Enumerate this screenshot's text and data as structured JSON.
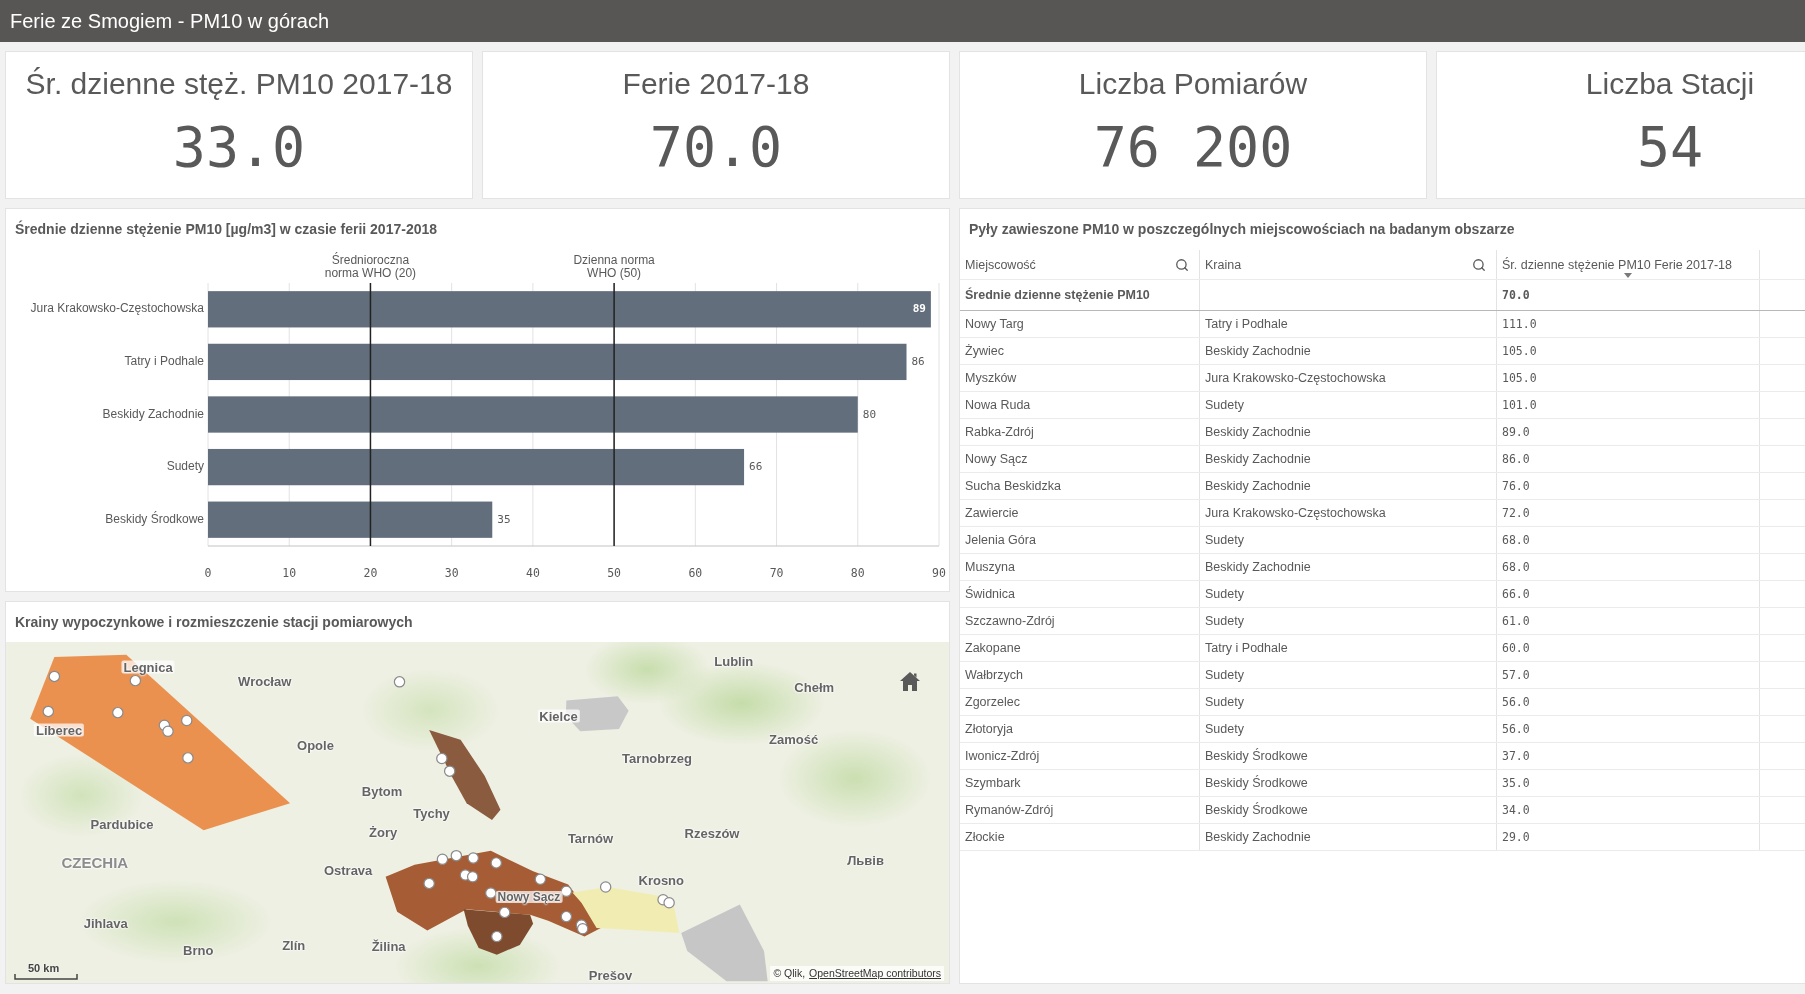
{
  "header": {
    "title": "Ferie ze Smogiem - PM10 w górach"
  },
  "kpis": [
    {
      "title": "Śr. dzienne stęż. PM10 2017-18",
      "value": "33.0"
    },
    {
      "title": "Ferie 2017-18",
      "value": "70.0"
    },
    {
      "title": "Liczba Pomiarów",
      "value": "76 200"
    },
    {
      "title": "Liczba Stacji",
      "value": "54"
    }
  ],
  "bar_chart": {
    "chart_data": {
      "type": "bar",
      "orientation": "horizontal",
      "title": "Średnie dzienne stężenie PM10 [µg/m3] w czasie ferii 2017-2018",
      "categories": [
        "Jura Krakowsko-Częstochowska",
        "Tatry i Podhale",
        "Beskidy Zachodnie",
        "Sudety",
        "Beskidy Środkowe"
      ],
      "values": [
        89,
        86,
        80,
        66,
        35
      ],
      "xlim": [
        0,
        90
      ],
      "xticks": [
        0,
        10,
        20,
        30,
        40,
        50,
        60,
        70,
        80,
        90
      ],
      "grid": true,
      "data_labels": true,
      "ref_lines": [
        {
          "axis": "x",
          "value": 20,
          "label": "Średnioroczna norma WHO (20)"
        },
        {
          "axis": "x",
          "value": 50,
          "label": "Dzienna norma WHO (50)"
        }
      ]
    }
  },
  "map": {
    "title": "Krainy wypoczynkowe i rozmieszczenie stacji pomiarowych",
    "areas": [
      {
        "color": "#c8c8c8"
      },
      {
        "color": "#ea9150"
      },
      {
        "color": "#8a5b3e"
      },
      {
        "color": "#a65c34"
      },
      {
        "color": "#7e4b2f"
      },
      {
        "color": "#f1edb2"
      },
      {
        "color": "#c6c6c6"
      }
    ],
    "place_labels": [
      {
        "text": "Legnica",
        "kind": "city"
      },
      {
        "text": "Wrocław",
        "kind": "city"
      },
      {
        "text": "Liberec",
        "kind": "city"
      },
      {
        "text": "Opole",
        "kind": "city"
      },
      {
        "text": "Bytom",
        "kind": "city"
      },
      {
        "text": "Tychy",
        "kind": "city"
      },
      {
        "text": "Żory",
        "kind": "city"
      },
      {
        "text": "Pardubice",
        "kind": "city"
      },
      {
        "text": "CZECHIA",
        "kind": "country"
      },
      {
        "text": "Ostrava",
        "kind": "city"
      },
      {
        "text": "Jihlava",
        "kind": "city"
      },
      {
        "text": "Brno",
        "kind": "city"
      },
      {
        "text": "Zlín",
        "kind": "city"
      },
      {
        "text": "Žilina",
        "kind": "city"
      },
      {
        "text": "Kielce",
        "kind": "city"
      },
      {
        "text": "Lublin",
        "kind": "city"
      },
      {
        "text": "Chełm",
        "kind": "city"
      },
      {
        "text": "Zamość",
        "kind": "city"
      },
      {
        "text": "Tarnobrzeg",
        "kind": "city"
      },
      {
        "text": "Tarnów",
        "kind": "city"
      },
      {
        "text": "Rzeszów",
        "kind": "city"
      },
      {
        "text": "Krosno",
        "kind": "city"
      },
      {
        "text": "Nowy Sącz",
        "kind": "city"
      },
      {
        "text": "Prešov",
        "kind": "city"
      },
      {
        "text": "Львів",
        "kind": "city"
      }
    ],
    "scale": "50 km",
    "attribution": {
      "text": "© Qlik,",
      "link": "OpenStreetMap contributors"
    }
  },
  "table": {
    "title": "Pyły zawieszone PM10 w poszczególnych miejscowościach na badanym obszarze",
    "columns": [
      {
        "label": "Miejscowość",
        "search": true,
        "sorted": false
      },
      {
        "label": "Kraina",
        "search": true,
        "sorted": false
      },
      {
        "label": "Śr. dzienne stężenie PM10 Ferie 2017-18",
        "search": false,
        "sorted": true
      }
    ],
    "totals": {
      "label": "Średnie dzienne stężenie PM10",
      "value": "70.0"
    },
    "rows": [
      [
        "Nowy Targ",
        "Tatry i Podhale",
        "111.0"
      ],
      [
        "Żywiec",
        "Beskidy Zachodnie",
        "105.0"
      ],
      [
        "Myszków",
        "Jura Krakowsko-Częstochowska",
        "105.0"
      ],
      [
        "Nowa Ruda",
        "Sudety",
        "101.0"
      ],
      [
        "Rabka-Zdrój",
        "Beskidy Zachodnie",
        "89.0"
      ],
      [
        "Nowy Sącz",
        "Beskidy Zachodnie",
        "86.0"
      ],
      [
        "Sucha Beskidzka",
        "Beskidy Zachodnie",
        "76.0"
      ],
      [
        "Zawiercie",
        "Jura Krakowsko-Częstochowska",
        "72.0"
      ],
      [
        "Jelenia Góra",
        "Sudety",
        "68.0"
      ],
      [
        "Muszyna",
        "Beskidy Zachodnie",
        "68.0"
      ],
      [
        "Świdnica",
        "Sudety",
        "66.0"
      ],
      [
        "Szczawno-Zdrój",
        "Sudety",
        "61.0"
      ],
      [
        "Zakopane",
        "Tatry i Podhale",
        "60.0"
      ],
      [
        "Wałbrzych",
        "Sudety",
        "57.0"
      ],
      [
        "Zgorzelec",
        "Sudety",
        "56.0"
      ],
      [
        "Złotoryja",
        "Sudety",
        "56.0"
      ],
      [
        "Iwonicz-Zdrój",
        "Beskidy Środkowe",
        "37.0"
      ],
      [
        "Szymbark",
        "Beskidy Środkowe",
        "35.0"
      ],
      [
        "Rymanów-Zdrój",
        "Beskidy Środkowe",
        "34.0"
      ],
      [
        "Złockie",
        "Beskidy Zachodnie",
        "29.0"
      ]
    ]
  }
}
